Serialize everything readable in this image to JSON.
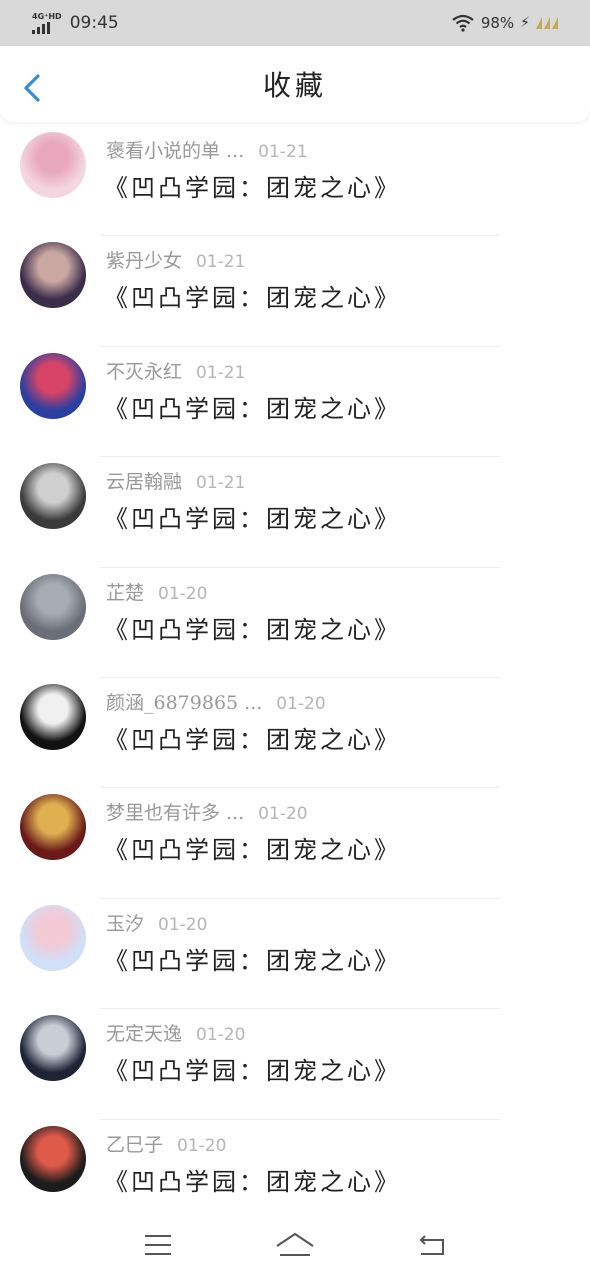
{
  "status_bar": {
    "network": "4G⁺HD",
    "time": "09:45",
    "battery": "98%"
  },
  "header": {
    "title": "收藏",
    "back_icon": "chevron-left-icon"
  },
  "items": [
    {
      "name": "褒看小说的单 ...",
      "date": "01-21",
      "title": "《凹凸学园：团宠之心》",
      "avatar_colors": [
        "#f4d6e0",
        "#e8a7bd"
      ]
    },
    {
      "name": "紫丹少女",
      "date": "01-21",
      "title": "《凹凸学园：团宠之心》",
      "avatar_colors": [
        "#3b2c4a",
        "#caa7a0"
      ]
    },
    {
      "name": "不灭永红",
      "date": "01-21",
      "title": "《凹凸学园：团宠之心》",
      "avatar_colors": [
        "#2a3fa0",
        "#d84466"
      ]
    },
    {
      "name": "云居翰融",
      "date": "01-21",
      "title": "《凹凸学园：团宠之心》",
      "avatar_colors": [
        "#3a3a3a",
        "#d0d0d0"
      ]
    },
    {
      "name": "芷楚",
      "date": "01-20",
      "title": "《凹凸学园：团宠之心》",
      "avatar_colors": [
        "#6a6e78",
        "#a8acb4"
      ]
    },
    {
      "name": "颜涵_6879865 ...",
      "date": "01-20",
      "title": "《凹凸学园：团宠之心》",
      "avatar_colors": [
        "#111111",
        "#f0f0f0"
      ]
    },
    {
      "name": "梦里也有许多 ...",
      "date": "01-20",
      "title": "《凹凸学园：团宠之心》",
      "avatar_colors": [
        "#6a1a1a",
        "#e0b050"
      ]
    },
    {
      "name": "玉汐",
      "date": "01-20",
      "title": "《凹凸学园：团宠之心》",
      "avatar_colors": [
        "#cfe0f8",
        "#f3c9d6"
      ]
    },
    {
      "name": "无定天逸",
      "date": "01-20",
      "title": "《凹凸学园：团宠之心》",
      "avatar_colors": [
        "#1e2436",
        "#c9cdd6"
      ]
    },
    {
      "name": "乙巳子",
      "date": "01-20",
      "title": "《凹凸学园：团宠之心》",
      "avatar_colors": [
        "#1c1c1c",
        "#e05a4a"
      ]
    }
  ],
  "nav_bar": {
    "menu_icon": "menu-icon",
    "home_icon": "home-icon",
    "back_icon": "back-icon"
  }
}
